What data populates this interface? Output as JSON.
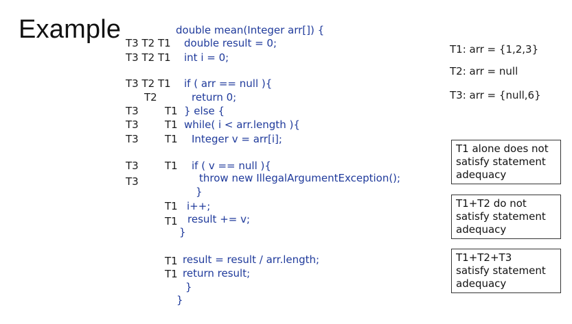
{
  "title": "Example",
  "code": {
    "signature": "double mean(Integer arr[]) {",
    "lines": [
      {
        "tags": "T3 T2 T1",
        "code": "double result = 0;"
      },
      {
        "tags": "T3 T2 T1",
        "code": "int i = 0;"
      },
      {
        "tags": "T3 T2 T1",
        "code": "if ( arr == null ){"
      },
      {
        "tags": "T2",
        "code": "return 0;"
      },
      {
        "tags": "T3",
        "code": ""
      },
      {
        "tags": "T1",
        "code": "} else {"
      },
      {
        "tags": "T3",
        "code": ""
      },
      {
        "tags": "T1",
        "code": "while( i < arr.length ){"
      },
      {
        "tags": "T3",
        "code": ""
      },
      {
        "tags": "T1",
        "code": "Integer v = arr[i];"
      },
      {
        "tags": "T3",
        "code": ""
      },
      {
        "tags": "T1",
        "code": "if ( v == null ){"
      },
      {
        "tags": "T3",
        "code": ""
      },
      {
        "tags": "",
        "code": "throw new IllegalArgumentException();"
      },
      {
        "tags": "",
        "code": "}"
      },
      {
        "tags": "T1",
        "code": "i++;"
      },
      {
        "tags": "T1",
        "code": "result += v;"
      },
      {
        "tags": "",
        "code": "}"
      },
      {
        "tags": "T1",
        "code": "result = result / arr.length;"
      },
      {
        "tags": "T1",
        "code": "return result;"
      },
      {
        "tags": "",
        "code": "}"
      },
      {
        "tags": "",
        "code": "}"
      }
    ]
  },
  "tests": [
    "T1: arr = {1,2,3}",
    "T2: arr = null",
    "T3: arr = {null,6}"
  ],
  "notes": [
    [
      "T1 alone does not",
      "satisfy statement",
      "adequacy"
    ],
    [
      "T1+T2 do not",
      "satisfy statement",
      "adequacy"
    ],
    [
      "T1+T2+T3",
      "satisfy statement",
      "adequacy"
    ]
  ]
}
